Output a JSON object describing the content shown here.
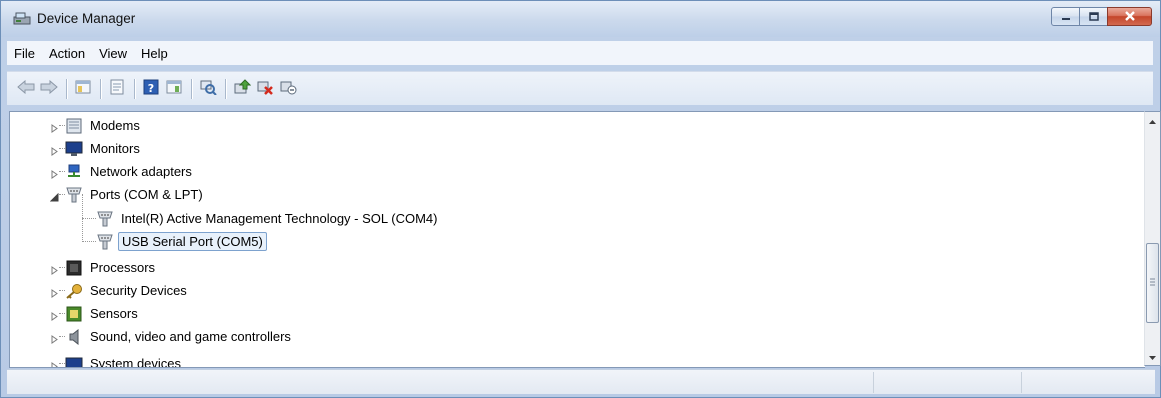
{
  "window": {
    "title": "Device Manager",
    "app_icon": "device-manager-icon"
  },
  "menu": {
    "items": [
      {
        "label": "File"
      },
      {
        "label": "Action"
      },
      {
        "label": "View"
      },
      {
        "label": "Help"
      }
    ]
  },
  "toolbar": {
    "buttons": [
      "back-arrow-icon",
      "forward-arrow-icon",
      "show-hide-console-tree-icon",
      "properties-icon",
      "help-icon",
      "action-pane-icon",
      "scan-hardware-icon",
      "update-driver-icon",
      "uninstall-icon",
      "disable-icon"
    ]
  },
  "tree": {
    "items": [
      {
        "label": "Modems",
        "icon": "modem-icon",
        "expanded": false
      },
      {
        "label": "Monitors",
        "icon": "monitor-icon",
        "expanded": false
      },
      {
        "label": "Network adapters",
        "icon": "network-adapter-icon",
        "expanded": false
      },
      {
        "label": "Ports (COM & LPT)",
        "icon": "port-icon",
        "expanded": true
      },
      {
        "label": "Intel(R) Active Management Technology - SOL (COM4)",
        "icon": "port-icon",
        "child": true
      },
      {
        "label": "USB Serial Port (COM5)",
        "icon": "port-icon",
        "child": true,
        "selected": true
      },
      {
        "label": "Processors",
        "icon": "processor-icon",
        "expanded": false
      },
      {
        "label": "Security Devices",
        "icon": "security-device-icon",
        "expanded": false
      },
      {
        "label": "Sensors",
        "icon": "sensor-icon",
        "expanded": false
      },
      {
        "label": "Sound, video and game controllers",
        "icon": "speaker-icon",
        "expanded": false
      },
      {
        "label": "System devices",
        "icon": "system-device-icon",
        "expanded": false
      }
    ]
  },
  "colors": {
    "selection_border": "#7da2ce",
    "selection_fill": "#e8f1fb",
    "close_button": "#c4452a"
  }
}
